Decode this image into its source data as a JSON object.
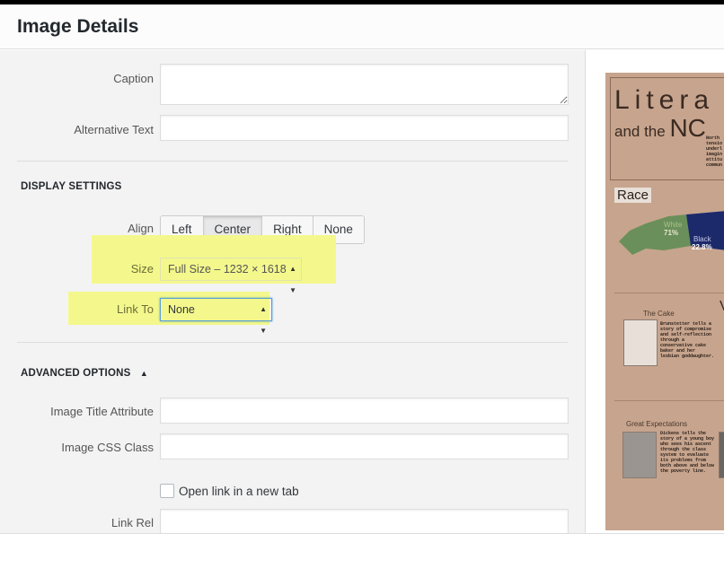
{
  "header": {
    "title": "Image Details"
  },
  "fields": {
    "caption_label": "Caption",
    "caption_value": "",
    "alt_label": "Alternative Text",
    "alt_value": ""
  },
  "display_settings": {
    "title": "DISPLAY SETTINGS",
    "align_label": "Align",
    "align_options": [
      "Left",
      "Center",
      "Right",
      "None"
    ],
    "align_selected": "Center",
    "size_label": "Size",
    "size_value": "Full Size – 1232 × 1618",
    "link_label": "Link To",
    "link_value": "None"
  },
  "advanced_options": {
    "title": "ADVANCED OPTIONS",
    "toggle_icon": "triangle-up-icon",
    "title_attr_label": "Image Title Attribute",
    "title_attr_value": "",
    "css_class_label": "Image CSS Class",
    "css_class_value": "",
    "new_tab_label": "Open link in a new tab",
    "new_tab_checked": false,
    "link_rel_label": "Link Rel",
    "link_rel_value": ""
  },
  "preview": {
    "title_line1": "Litera",
    "title_line2_prefix": "and the ",
    "title_line2_big": "NC",
    "section_race": "Race",
    "white_label": "White",
    "white_value": "71%",
    "black_label": "Black",
    "black_value": "22.8%",
    "cake_title": "The Cake",
    "cake_text": "Brunstetter tells a story of compromise and self-reflection through a conservative cake baker and her lesbian goddaughter.",
    "great_title": "Great Expectations",
    "great_text": "Dickens tells the story of a young boy who sees his ascent through the class system to evaluate its problems from both above and below the poverty line.",
    "intro_text": "North tensio underl imagin attitu commun"
  },
  "colors": {
    "highlight": "#f4f88c",
    "poster_bg": "#c7a48d",
    "map_white": "#6b8f5a",
    "map_black": "#1c2a6b"
  }
}
